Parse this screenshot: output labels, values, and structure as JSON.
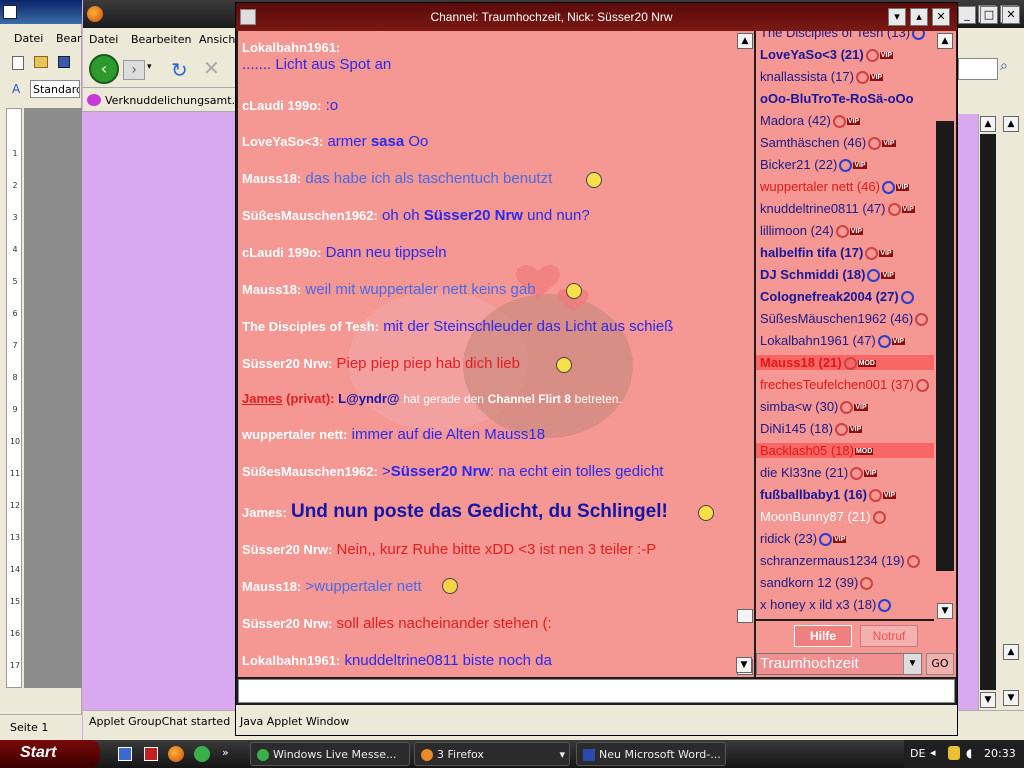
{
  "word": {
    "menu": [
      "Datei",
      "Bear"
    ],
    "style_box": "Standard",
    "status": "Seite  1",
    "ruler": [
      "1",
      "2",
      "3",
      "4",
      "5",
      "6",
      "7",
      "8",
      "9",
      "10",
      "11",
      "12",
      "13",
      "14",
      "15",
      "16",
      "17"
    ]
  },
  "firefox": {
    "menu": [
      "Datei",
      "Bearbeiten",
      "Ansicht"
    ],
    "tab_label": "Verknuddelichungsamt...",
    "status": "Applet GroupChat started"
  },
  "applet": {
    "title": "Channel: Traumhochzeit,  Nick: Süsser20 Nrw",
    "footer": "Java Applet Window",
    "help_label": "Hilfe",
    "emergency_label": "Notruf",
    "channel_value": "Traumhochzeit",
    "go_label": "GO"
  },
  "messages": [
    {
      "nick": "Lokalbahn1961:",
      "text": "....... Licht aus Spot an"
    },
    {
      "nick": "cLaudi 199o:",
      "text": ":o"
    },
    {
      "nick": "LoveYaSo<3:",
      "text": "armer",
      "bold": "sasa",
      "tail": " Oo"
    },
    {
      "nick": "Mauss18:",
      "text": "das habe ich als taschentuch benutzt"
    },
    {
      "nick": "SüßesMauschen1962:",
      "text": "oh oh",
      "bold": "Süsser20 Nrw",
      "tail": "  und nun?"
    },
    {
      "nick": "cLaudi 199o:",
      "text": "Dann neu tippseln"
    },
    {
      "nick": "Mauss18:",
      "text": "weil mit wuppertaler nett keins gab"
    },
    {
      "nick": "The Disciples of Tesh:",
      "text": "mit der Steinschleuder das Licht aus schieß"
    },
    {
      "nick": "Süsser20 Nrw:",
      "text": "Piep piep piep hab dich lieb"
    },
    {
      "nick": "James",
      "private": "(privat):",
      "who": "L@yndr@",
      "text": "hat gerade den",
      "bold": "Channel Flirt 8",
      "tail": "betreten."
    },
    {
      "nick": "wuppertaler nett:",
      "text": "immer auf die Alten Mauss18"
    },
    {
      "nick": "SüßesMauschen1962:",
      "text": ">",
      "bold": "Süsser20 Nrw",
      "tail": ": na echt ein tolles gedicht"
    },
    {
      "nick": "James:",
      "text": "Und nun poste das Gedicht, du Schlingel!"
    },
    {
      "nick": "Süsser20 Nrw:",
      "text": "Nein,, kurz Ruhe bitte xDD <3 ist nen 3 teiler :-P"
    },
    {
      "nick": "Mauss18:",
      "text": ">wuppertaler nett"
    },
    {
      "nick": "Süsser20 Nrw:",
      "text": "soll alles nacheinander stehen (:"
    },
    {
      "nick": "Lokalbahn1961:",
      "text": "knuddeltrine0811  biste noch da"
    }
  ],
  "users": [
    "The Disciples of Tesh (13)",
    "LoveYaSo<3 (21)",
    "knallassista (17)",
    "oOo-BluTroTe-RoSä-oOo",
    "Madora (42)",
    "Samthäschen (46)",
    "Bicker21 (22)",
    "wuppertaler nett (46)",
    "knuddeltrine0811 (47)",
    "lillimoon (24)",
    "halbelfin tifa (17)",
    "DJ Schmiddi (18)",
    "Colognefreak2004 (27)",
    "SüßesMäuschen1962 (46)",
    "Lokalbahn1961 (47)",
    "Mauss18 (21)",
    "frechesTeufelchen001 (37)",
    "simba<w (30)",
    "DiNi145 (18)",
    "Backlash05 (18)",
    "die Kl33ne (21)",
    "fußballbaby1 (16)",
    "MoonBunny87 (21)",
    "ridick (23)",
    "schranzermaus1234 (19)",
    "sandkorn 12 (39)",
    "x honey x ild x3 (18)"
  ],
  "badges": {
    "vip": "VIP",
    "mod": "MOD"
  },
  "taskbar": {
    "start": "Start",
    "tasks": [
      "Windows Live Messe...",
      "3 Firefox",
      "Neu Microsoft Word-..."
    ],
    "lang": "DE",
    "clock": "20:33"
  }
}
